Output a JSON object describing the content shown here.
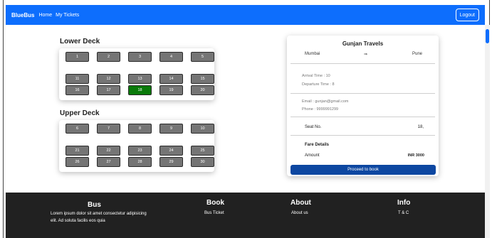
{
  "navbar": {
    "brand": "BlueBus",
    "links": [
      "Home",
      "My Tickets"
    ],
    "logout": "Logout",
    "color": "#0d6efd"
  },
  "lower_deck": {
    "title": "Lower Deck",
    "seats": [
      "1",
      "2",
      "3",
      "4",
      "5",
      "11",
      "12",
      "13",
      "14",
      "15",
      "16",
      "17",
      "18",
      "19",
      "20"
    ],
    "selected": "18"
  },
  "upper_deck": {
    "title": "Upper Deck",
    "seats": [
      "6",
      "7",
      "8",
      "9",
      "10",
      "21",
      "22",
      "23",
      "24",
      "25",
      "26",
      "27",
      "28",
      "29",
      "30"
    ]
  },
  "card": {
    "title": "Gunjan Travels",
    "from": "Mumbai",
    "arrow": "⇒",
    "to": "Pune",
    "arrival": "Arrival Time : 10",
    "departure": "Departure Time : 8",
    "email": "Email : gunjan@gmail.com",
    "phone": "Phone : 9999991299",
    "seat_label": "Seat No.",
    "seat_value": "18,",
    "fare_title": "Fare Details",
    "amount_label": "Amount",
    "amount_value": "INR 3000",
    "proceed": "Proceed to book"
  },
  "footer": {
    "bus_title": "Bus",
    "bus_text": "Lorem ipsum dolor sit amet consectetur adipisicing elit. Ad soluta facilis eos quia",
    "book_title": "Book",
    "book_link": "Bus Ticket",
    "about_title": "About",
    "about_link": "About us",
    "info_title": "Info",
    "info_link": "T & C"
  },
  "colors": {
    "seat": "#757575",
    "selected_seat": "#0a7a0a",
    "button": "#0d47a1",
    "footer": "#212121"
  }
}
